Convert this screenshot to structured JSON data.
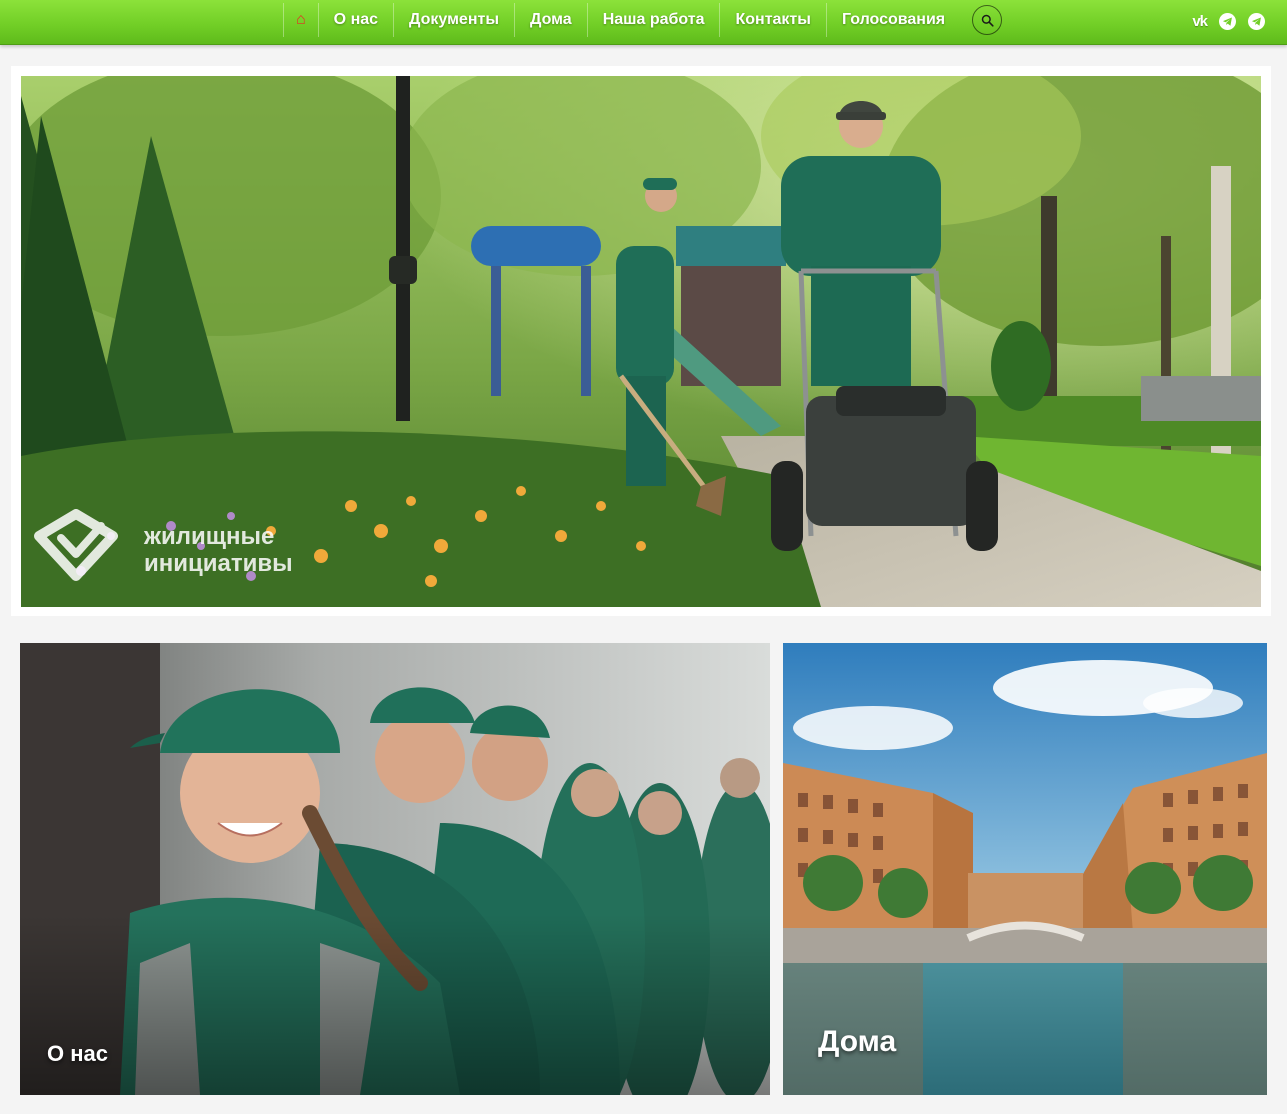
{
  "nav": {
    "items": [
      {
        "label": "О нас"
      },
      {
        "label": "Документы"
      },
      {
        "label": "Дома"
      },
      {
        "label": "Наша работа"
      },
      {
        "label": "Контакты"
      },
      {
        "label": "Голосования"
      }
    ],
    "home_icon": "home-icon",
    "search_icon": "search-icon",
    "socials": [
      {
        "name": "vk",
        "icon": "vk-icon",
        "glyph": "vk"
      },
      {
        "name": "telegram",
        "icon": "telegram-icon"
      },
      {
        "name": "telegram",
        "icon": "telegram-icon"
      }
    ]
  },
  "hero": {
    "logo_line1": "жилищные",
    "logo_line2": "инициативы"
  },
  "cards": {
    "about_label": "О нас",
    "homes_label": "Дома"
  },
  "colors": {
    "nav_green": "#72cf27",
    "uniform_green": "#1f6e57",
    "home_icon_red": "#e52f25"
  }
}
